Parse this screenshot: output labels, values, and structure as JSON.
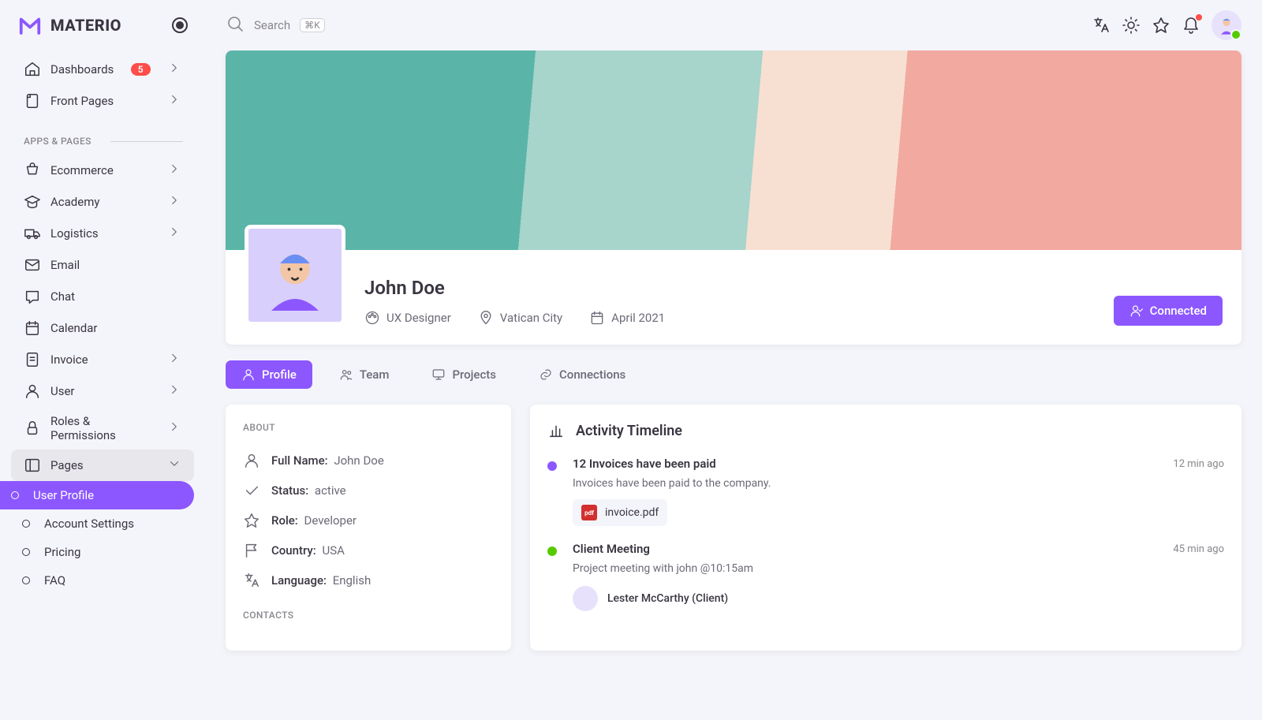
{
  "brand": {
    "name": "MATERIO"
  },
  "topbar": {
    "search_placeholder": "Search",
    "shortcut": "⌘K"
  },
  "sidebar": {
    "items": [
      {
        "label": "Dashboards",
        "badge": "5"
      },
      {
        "label": "Front Pages"
      }
    ],
    "section_label": "APPS & PAGES",
    "apps": [
      {
        "label": "Ecommerce"
      },
      {
        "label": "Academy"
      },
      {
        "label": "Logistics"
      },
      {
        "label": "Email"
      },
      {
        "label": "Chat"
      },
      {
        "label": "Calendar"
      },
      {
        "label": "Invoice"
      },
      {
        "label": "User"
      },
      {
        "label": "Roles & Permissions"
      },
      {
        "label": "Pages"
      }
    ],
    "subpages": [
      {
        "label": "User Profile"
      },
      {
        "label": "Account Settings"
      },
      {
        "label": "Pricing"
      },
      {
        "label": "FAQ"
      }
    ]
  },
  "profile": {
    "name": "John Doe",
    "role": "UX Designer",
    "location": "Vatican City",
    "joined": "April 2021",
    "connect_label": "Connected"
  },
  "tabs": [
    {
      "label": "Profile"
    },
    {
      "label": "Team"
    },
    {
      "label": "Projects"
    },
    {
      "label": "Connections"
    }
  ],
  "about": {
    "heading": "ABOUT",
    "rows": [
      {
        "k": "Full Name:",
        "v": "John Doe"
      },
      {
        "k": "Status:",
        "v": "active"
      },
      {
        "k": "Role:",
        "v": "Developer"
      },
      {
        "k": "Country:",
        "v": "USA"
      },
      {
        "k": "Language:",
        "v": "English"
      }
    ],
    "contacts_heading": "CONTACTS"
  },
  "timeline": {
    "heading": "Activity Timeline",
    "items": [
      {
        "dot_color": "#8c57ff",
        "title": "12 Invoices have been paid",
        "time": "12 min ago",
        "desc": "Invoices have been paid to the company.",
        "attachment": "invoice.pdf"
      },
      {
        "dot_color": "#56ca00",
        "title": "Client Meeting",
        "time": "45 min ago",
        "desc": "Project meeting with john @10:15am",
        "user": "Lester McCarthy (Client)"
      }
    ]
  }
}
